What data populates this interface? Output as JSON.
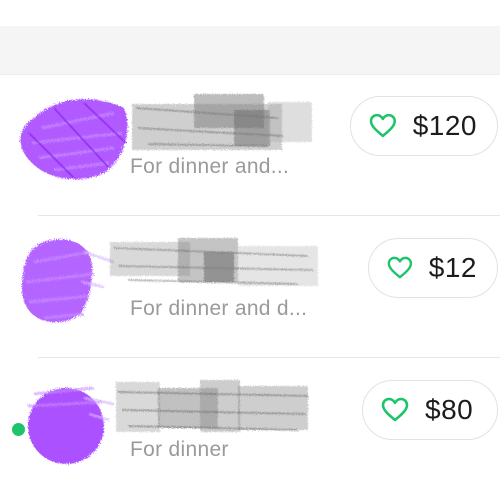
{
  "colors": {
    "accent_green": "#1ec46a",
    "avatar_purple": "#9b30ff",
    "note_gray": "#9a9a9a"
  },
  "transactions": [
    {
      "note": "For dinner and...",
      "amount": "$120",
      "icon": "heart-icon"
    },
    {
      "note": "For dinner and d...",
      "amount": "$12",
      "icon": "heart-icon"
    },
    {
      "note": "For dinner",
      "amount": "$80",
      "icon": "heart-icon"
    }
  ]
}
